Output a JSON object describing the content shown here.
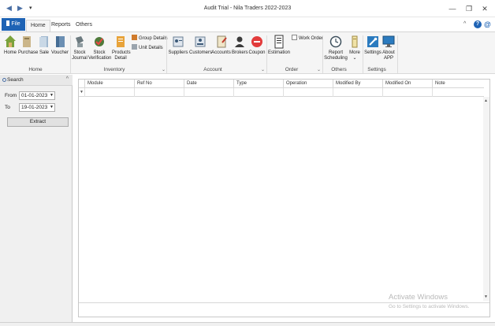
{
  "window": {
    "title": "Audit Trial - Nila Traders 2022-2023",
    "controls": [
      "—",
      "❐",
      "✕"
    ]
  },
  "quick_access": {
    "back": "◀",
    "forward": "▶",
    "menu": "▾"
  },
  "tabs": {
    "file": "File",
    "items": [
      "Home",
      "Reports",
      "Others"
    ],
    "active": "Home"
  },
  "top_right": {
    "collapse": "^",
    "help": "?",
    "at": "@"
  },
  "ribbon": {
    "home_group": {
      "label": "Home",
      "buttons": [
        "Home",
        "Purchase",
        "Sale",
        "Voucher"
      ]
    },
    "inventory_group": {
      "label": "Inventory",
      "buttons": [
        {
          "line1": "Stock",
          "line2": "Journal"
        },
        {
          "line1": "Stock",
          "line2": "Verification"
        },
        {
          "line1": "Products",
          "line2": "Detail"
        }
      ],
      "small_buttons": [
        "Group Details",
        "Unit Details"
      ]
    },
    "account_group": {
      "label": "Account",
      "buttons": [
        "Suppliers",
        "Customers",
        "Accounts",
        "Brokers",
        "Coupon"
      ]
    },
    "order_group": {
      "label": "Order",
      "buttons": [
        "Estimation"
      ],
      "small_buttons": [
        "Work Order"
      ]
    },
    "others_group": {
      "label": "Others",
      "buttons": [
        {
          "line1": "Report",
          "line2": "Scheduling"
        },
        {
          "line1": "More",
          "line2": "⌄"
        }
      ]
    },
    "settings_group": {
      "label": "Settings",
      "buttons": [
        {
          "line1": "Settings",
          "line2": ""
        },
        {
          "line1": "About",
          "line2": "APP"
        }
      ]
    }
  },
  "search_panel": {
    "title": "Search",
    "from_label": "From",
    "from_value": "01-01-2023",
    "to_label": "To",
    "to_value": "19-01-2023",
    "extract_label": "Extract"
  },
  "grid": {
    "columns": [
      "Module",
      "Ref No",
      "Date",
      "Type",
      "Operation",
      "Modified By",
      "Modified On",
      "Note"
    ]
  },
  "watermark": {
    "line1": "Activate Windows",
    "line2": "Go to Settings to activate Windows."
  },
  "colors": {
    "accent": "#1e63b5",
    "ribbon_bg": "#f5f5f5",
    "panel_bg": "#f0f0f0"
  }
}
